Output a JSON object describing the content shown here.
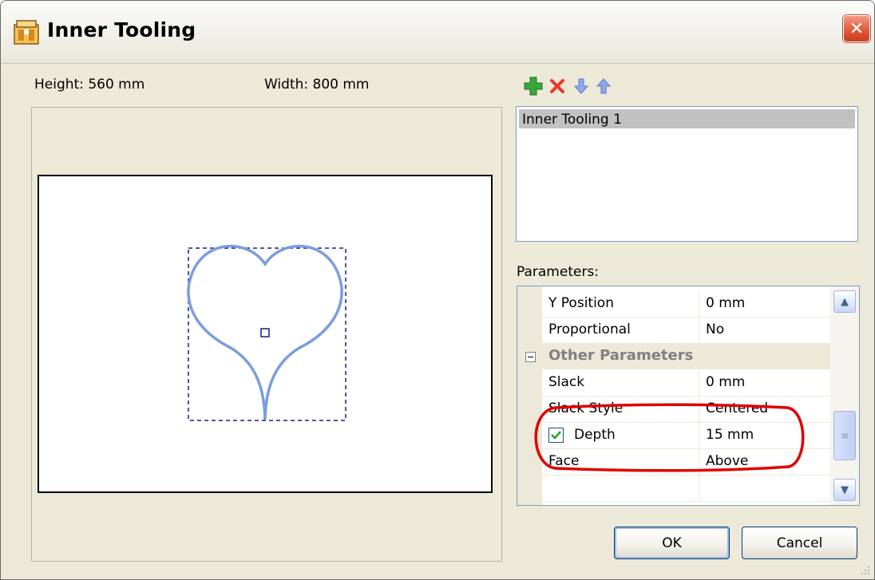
{
  "window": {
    "title": "Inner Tooling",
    "close_symbol": "✕"
  },
  "dimensions": {
    "height_label": "Height: 560 mm",
    "width_label": "Width: 800 mm"
  },
  "toolbar": {
    "icons": [
      "add-green-plus-icon",
      "delete-red-x-icon",
      "move-down-arrow-icon",
      "move-up-arrow-icon"
    ]
  },
  "tooling_list": {
    "items": [
      "Inner Tooling 1"
    ],
    "selected_index": 0
  },
  "parameters": {
    "label": "Parameters:",
    "rows": [
      {
        "name": "Y Position",
        "value": "0 mm"
      },
      {
        "name": "Proportional",
        "value": "No"
      }
    ],
    "category": "Other Parameters",
    "category_rows": [
      {
        "name": "Slack",
        "value": "0 mm"
      },
      {
        "name": "Slack Style",
        "value": "Centered"
      },
      {
        "name": "Depth",
        "value": "15 mm",
        "checked": true
      },
      {
        "name": "Face",
        "value": "Above"
      }
    ]
  },
  "buttons": {
    "ok": "OK",
    "cancel": "Cancel"
  },
  "colors": {
    "shape_stroke": "#7a9de0",
    "selection_box": "#1a1a8c",
    "highlight_ellipse": "#e00000",
    "dialog_bg": "#ece9d8"
  }
}
